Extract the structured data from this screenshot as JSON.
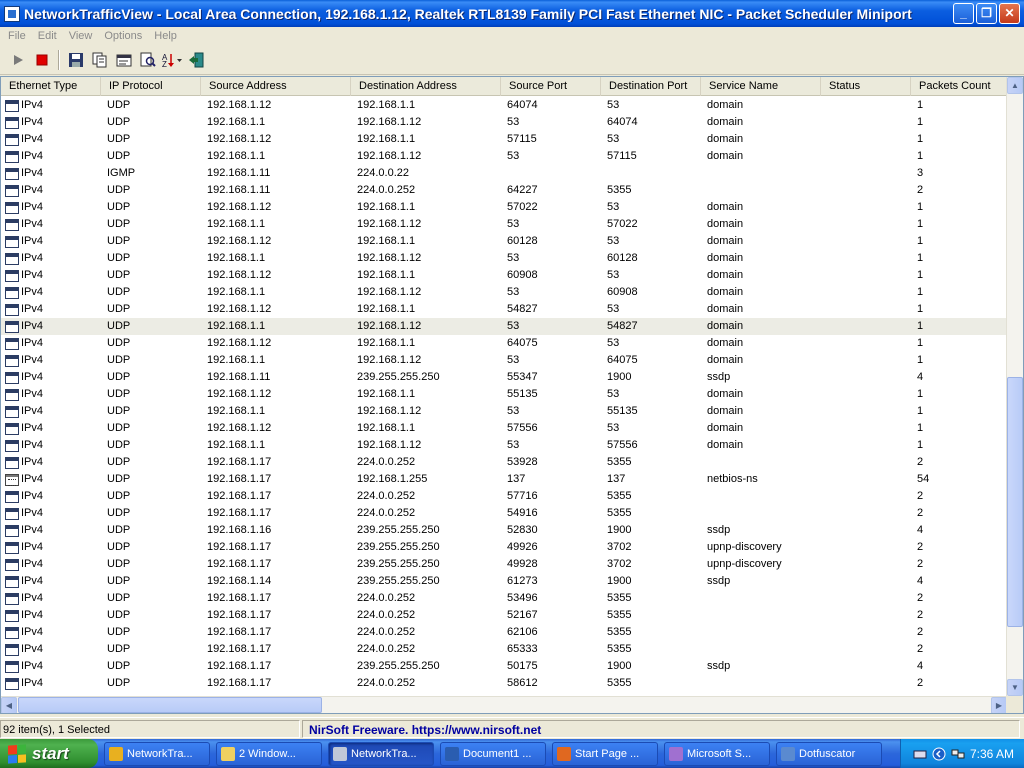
{
  "window": {
    "title": "NetworkTrafficView  -  Local Area Connection, 192.168.1.12, Realtek RTL8139 Family PCI Fast Ethernet NIC - Packet Scheduler Miniport",
    "minimize": "_",
    "maximize": "❐",
    "close": "✕"
  },
  "menu": [
    "File",
    "Edit",
    "View",
    "Options",
    "Help"
  ],
  "toolbar": {
    "buttons": [
      "play-icon",
      "stop-icon",
      "save-icon",
      "copy-icon",
      "properties-icon",
      "find-icon",
      "sort-icon",
      "exit-icon"
    ]
  },
  "columns": [
    "Ethernet Type",
    "IP Protocol",
    "Source Address",
    "Destination Address",
    "Source Port",
    "Destination Port",
    "Service Name",
    "Status",
    "Packets Count"
  ],
  "rows": [
    [
      "IPv4",
      "UDP",
      "192.168.1.12",
      "192.168.1.1",
      "64074",
      "53",
      "domain",
      "",
      "1"
    ],
    [
      "IPv4",
      "UDP",
      "192.168.1.1",
      "192.168.1.12",
      "53",
      "64074",
      "domain",
      "",
      "1"
    ],
    [
      "IPv4",
      "UDP",
      "192.168.1.12",
      "192.168.1.1",
      "57115",
      "53",
      "domain",
      "",
      "1"
    ],
    [
      "IPv4",
      "UDP",
      "192.168.1.1",
      "192.168.1.12",
      "53",
      "57115",
      "domain",
      "",
      "1"
    ],
    [
      "IPv4",
      "IGMP",
      "192.168.1.11",
      "224.0.0.22",
      "",
      "",
      "",
      "",
      "3"
    ],
    [
      "IPv4",
      "UDP",
      "192.168.1.11",
      "224.0.0.252",
      "64227",
      "5355",
      "",
      "",
      "2"
    ],
    [
      "IPv4",
      "UDP",
      "192.168.1.12",
      "192.168.1.1",
      "57022",
      "53",
      "domain",
      "",
      "1"
    ],
    [
      "IPv4",
      "UDP",
      "192.168.1.1",
      "192.168.1.12",
      "53",
      "57022",
      "domain",
      "",
      "1"
    ],
    [
      "IPv4",
      "UDP",
      "192.168.1.12",
      "192.168.1.1",
      "60128",
      "53",
      "domain",
      "",
      "1"
    ],
    [
      "IPv4",
      "UDP",
      "192.168.1.1",
      "192.168.1.12",
      "53",
      "60128",
      "domain",
      "",
      "1"
    ],
    [
      "IPv4",
      "UDP",
      "192.168.1.12",
      "192.168.1.1",
      "60908",
      "53",
      "domain",
      "",
      "1"
    ],
    [
      "IPv4",
      "UDP",
      "192.168.1.1",
      "192.168.1.12",
      "53",
      "60908",
      "domain",
      "",
      "1"
    ],
    [
      "IPv4",
      "UDP",
      "192.168.1.12",
      "192.168.1.1",
      "54827",
      "53",
      "domain",
      "",
      "1"
    ],
    [
      "IPv4",
      "UDP",
      "192.168.1.1",
      "192.168.1.12",
      "53",
      "54827",
      "domain",
      "",
      "1"
    ],
    [
      "IPv4",
      "UDP",
      "192.168.1.12",
      "192.168.1.1",
      "64075",
      "53",
      "domain",
      "",
      "1"
    ],
    [
      "IPv4",
      "UDP",
      "192.168.1.1",
      "192.168.1.12",
      "53",
      "64075",
      "domain",
      "",
      "1"
    ],
    [
      "IPv4",
      "UDP",
      "192.168.1.11",
      "239.255.255.250",
      "55347",
      "1900",
      "ssdp",
      "",
      "4"
    ],
    [
      "IPv4",
      "UDP",
      "192.168.1.12",
      "192.168.1.1",
      "55135",
      "53",
      "domain",
      "",
      "1"
    ],
    [
      "IPv4",
      "UDP",
      "192.168.1.1",
      "192.168.1.12",
      "53",
      "55135",
      "domain",
      "",
      "1"
    ],
    [
      "IPv4",
      "UDP",
      "192.168.1.12",
      "192.168.1.1",
      "57556",
      "53",
      "domain",
      "",
      "1"
    ],
    [
      "IPv4",
      "UDP",
      "192.168.1.1",
      "192.168.1.12",
      "53",
      "57556",
      "domain",
      "",
      "1"
    ],
    [
      "IPv4",
      "UDP",
      "192.168.1.17",
      "224.0.0.252",
      "53928",
      "5355",
      "",
      "",
      "2"
    ],
    [
      "IPv4",
      "UDP",
      "192.168.1.17",
      "192.168.1.255",
      "137",
      "137",
      "netbios-ns",
      "",
      "54"
    ],
    [
      "IPv4",
      "UDP",
      "192.168.1.17",
      "224.0.0.252",
      "57716",
      "5355",
      "",
      "",
      "2"
    ],
    [
      "IPv4",
      "UDP",
      "192.168.1.17",
      "224.0.0.252",
      "54916",
      "5355",
      "",
      "",
      "2"
    ],
    [
      "IPv4",
      "UDP",
      "192.168.1.16",
      "239.255.255.250",
      "52830",
      "1900",
      "ssdp",
      "",
      "4"
    ],
    [
      "IPv4",
      "UDP",
      "192.168.1.17",
      "239.255.255.250",
      "49926",
      "3702",
      "upnp-discovery",
      "",
      "2"
    ],
    [
      "IPv4",
      "UDP",
      "192.168.1.17",
      "239.255.255.250",
      "49928",
      "3702",
      "upnp-discovery",
      "",
      "2"
    ],
    [
      "IPv4",
      "UDP",
      "192.168.1.14",
      "239.255.255.250",
      "61273",
      "1900",
      "ssdp",
      "",
      "4"
    ],
    [
      "IPv4",
      "UDP",
      "192.168.1.17",
      "224.0.0.252",
      "53496",
      "5355",
      "",
      "",
      "2"
    ],
    [
      "IPv4",
      "UDP",
      "192.168.1.17",
      "224.0.0.252",
      "52167",
      "5355",
      "",
      "",
      "2"
    ],
    [
      "IPv4",
      "UDP",
      "192.168.1.17",
      "224.0.0.252",
      "62106",
      "5355",
      "",
      "",
      "2"
    ],
    [
      "IPv4",
      "UDP",
      "192.168.1.17",
      "224.0.0.252",
      "65333",
      "5355",
      "",
      "",
      "2"
    ],
    [
      "IPv4",
      "UDP",
      "192.168.1.17",
      "239.255.255.250",
      "50175",
      "1900",
      "ssdp",
      "",
      "4"
    ],
    [
      "IPv4",
      "UDP",
      "192.168.1.17",
      "224.0.0.252",
      "58612",
      "5355",
      "",
      "",
      "2"
    ]
  ],
  "selected_row": 13,
  "alt_icon_row": 22,
  "status": {
    "items": "92 item(s), 1 Selected",
    "link": "NirSoft Freeware.  https://www.nirsoft.net"
  },
  "taskbar": {
    "start_label": "start",
    "tasks": [
      {
        "label": "NetworkTra...",
        "icon": "chrome-icon",
        "color": "#e8b020"
      },
      {
        "label": "2 Window...",
        "icon": "folder-icon",
        "color": "#f0d060"
      },
      {
        "label": "NetworkTra...",
        "icon": "app-icon",
        "color": "#c0c8d8",
        "active": true
      },
      {
        "label": "Document1 ...",
        "icon": "word-icon",
        "color": "#2a5db0"
      },
      {
        "label": "Start Page ...",
        "icon": "star-icon",
        "color": "#e06820"
      },
      {
        "label": "Microsoft S...",
        "icon": "vs-icon",
        "color": "#a070d0"
      },
      {
        "label": "Dotfuscator",
        "icon": "gear-icon",
        "color": "#5a8ad0"
      }
    ],
    "clock": "7:36 AM"
  }
}
